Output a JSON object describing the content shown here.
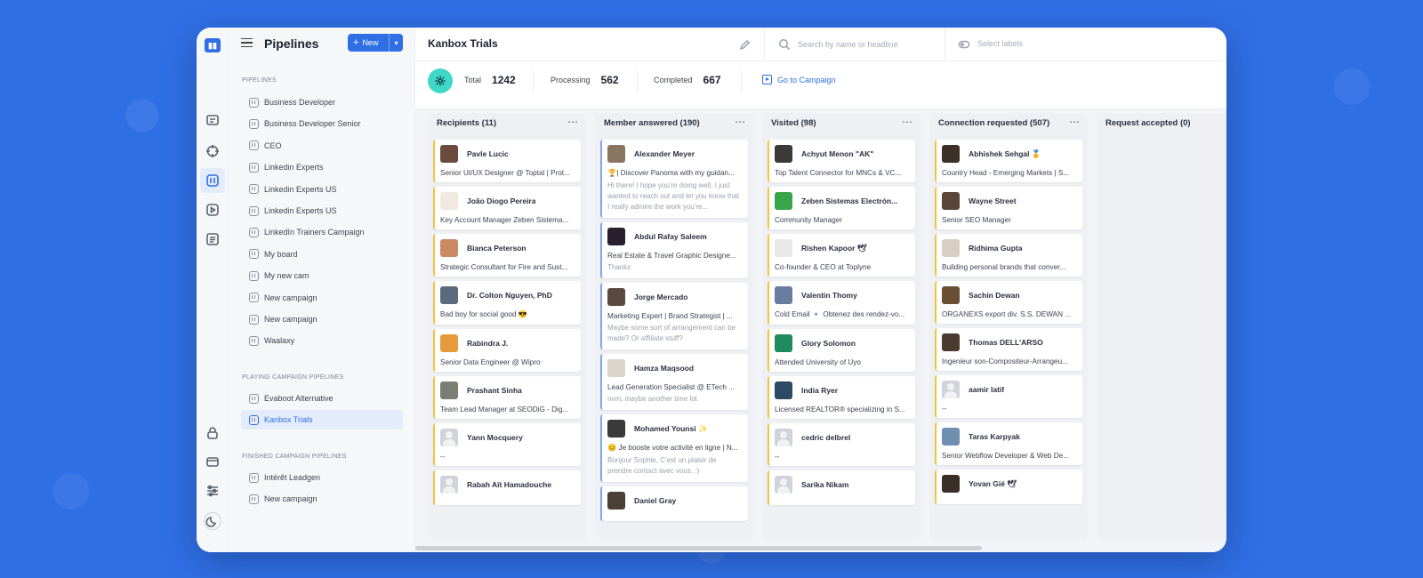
{
  "sidebar": {
    "title": "Pipelines",
    "new_label": "New",
    "sections": {
      "pipelines": "PIPELINES",
      "playing": "PLAYING CAMPAIGN PIPELINES",
      "finished": "FINISHED CAMPAIGN PIPELINES"
    },
    "pipelines": [
      "Business Developer",
      "Business Developer Senior",
      "CEO",
      "Linkedin Experts",
      "Linkedin Experts US",
      "Linkedin Experts US",
      "LinkedIn Trainers Campaign",
      "My board",
      "My new cam",
      "New campaign",
      "New campaign",
      "Waalaxy"
    ],
    "playing": [
      "Evaboot Alternative",
      "Kanbox Trials"
    ],
    "finished": [
      "Intérêt Leadgen",
      "New campaign"
    ]
  },
  "header": {
    "board_title": "Kanbox Trials",
    "search_placeholder": "Search by name or headline",
    "labels_placeholder": "Select labels"
  },
  "stats": {
    "total_label": "Total",
    "total": "1242",
    "processing_label": "Processing",
    "processing": "562",
    "completed_label": "Completed",
    "completed": "667",
    "campaign_link": "Go to Campaign"
  },
  "colors": {
    "accent": "#2f6fe6",
    "teal": "#3fd8c8",
    "card_yellow": "#f0c542",
    "card_blue": "#7ea7ef"
  },
  "columns": [
    {
      "title": "Recipients (11)",
      "cards": [
        {
          "name": "Pavle Lucic",
          "headline": "Senior UI/UX Designer @ Toptal | Prot...",
          "avatar": "#6b4b3e"
        },
        {
          "name": "João Diogo Pereira",
          "headline": "Key Account Manager Zeben Sistema...",
          "avatar": "#f1e9e0"
        },
        {
          "name": "Bianca Peterson",
          "headline": "Strategic Consultant for Fire and Sust...",
          "avatar": "#c98a63"
        },
        {
          "name": "Dr. Colton Nguyen, PhD",
          "headline": "Bad boy for social good 😎",
          "avatar": "#5a6b7d"
        },
        {
          "name": "Rabindra J.",
          "headline": "Senior Data Engineer @ Wipro",
          "avatar": "#e59b3c"
        },
        {
          "name": "Prashant Sinha",
          "headline": "Team Lead Manager at SEODiG - Dig...",
          "avatar": "#7a7f74"
        },
        {
          "name": "Yann Mocquery",
          "headline": "--",
          "avatar": ""
        },
        {
          "name": "Rabah Aït Hamadouche",
          "headline": "",
          "avatar": ""
        }
      ]
    },
    {
      "title": "Member answered (190)",
      "cards": [
        {
          "name": "Alexander Meyer",
          "headline": "🏆| Discover Panoma with my guidan...",
          "msg": "Hi there! I hope you're doing well. I just wanted to reach out and let you know that I really admire the work you're...",
          "avatar": "#8a7560"
        },
        {
          "name": "Abdul Rafay Saleem",
          "headline": "Real Estate & Travel Graphic Designe...",
          "msg": "Thanks",
          "avatar": "#2a1f2d"
        },
        {
          "name": "Jorge Mercado",
          "headline": "Marketing Expert | Brand Strategist | ...",
          "msg": "Maybe some sort of arrangement can be made? Or affiliate stuff?",
          "avatar": "#5b4a3f"
        },
        {
          "name": "Hamza Maqsood",
          "headline": "Lead Generation Specialist @ ETech ...",
          "msg": "nvm, maybe another time lol.",
          "avatar": "#d9d4cc"
        },
        {
          "name": "Mohamed Younsi ✨",
          "headline": "😊 Je booste votre activité en ligne | N...",
          "msg": "Bonjour Sophie, C'est un plaisir de prendre contact avec vous. :)",
          "avatar": "#3a3a3a"
        },
        {
          "name": "Daniel Gray",
          "headline": "",
          "msg": "",
          "avatar": "#4a4036"
        }
      ]
    },
    {
      "title": "Visited (98)",
      "cards": [
        {
          "name": "Achyut Menon \"AK\"",
          "headline": "Top Talent Connector for MNCs & VC...",
          "avatar": "#3c3a36"
        },
        {
          "name": "Zeben Sistemas Electrón...",
          "headline": "Community Manager",
          "avatar": "#3aa64a"
        },
        {
          "name": "Rishen Kapoor 🕊",
          "headline": "Co-founder & CEO at Toplyne",
          "avatar": "#e8e8e8"
        },
        {
          "name": "Valentin Thomy",
          "headline": "Cold Email 🔹 Obtenez des rendez-vo...",
          "avatar": "#6a7ba0"
        },
        {
          "name": "Glory Solomon",
          "headline": "Attended University of Uyo",
          "avatar": "#1f8a5c"
        },
        {
          "name": "India Ryer",
          "headline": "Licensed REALTOR® specializing in S...",
          "avatar": "#2c4a63"
        },
        {
          "name": "cedric delbrel",
          "headline": "--",
          "avatar": ""
        },
        {
          "name": "Sarika Nikam",
          "headline": "",
          "avatar": ""
        }
      ]
    },
    {
      "title": "Connection requested (507)",
      "cards": [
        {
          "name": "Abhishek Sehgal 🏅",
          "headline": "Country Head - Emerging Markets | S...",
          "avatar": "#3b3128"
        },
        {
          "name": "Wayne Street",
          "headline": "Senior SEO Manager",
          "avatar": "#5a4638"
        },
        {
          "name": "Ridhima Gupta",
          "headline": "Building personal brands that conver...",
          "avatar": "#d7cfc4"
        },
        {
          "name": "Sachin Dewan",
          "headline": "ORGANEXS export div. S.S. DEWAN ...",
          "avatar": "#6a4e35"
        },
        {
          "name": "Thomas DELL'ARSO",
          "headline": "Ingenieur son-Compositeur-Arrangeu...",
          "avatar": "#4a3a30"
        },
        {
          "name": "aamir latif",
          "headline": "--",
          "avatar": ""
        },
        {
          "name": "Taras Karpyak",
          "headline": "Senior Webflow Developer & Web De...",
          "avatar": "#6f8fb0"
        },
        {
          "name": "Yovan Gié 🕊",
          "headline": "",
          "avatar": "#3a2e28"
        }
      ]
    },
    {
      "title": "Request accepted (0)",
      "cards": []
    }
  ]
}
